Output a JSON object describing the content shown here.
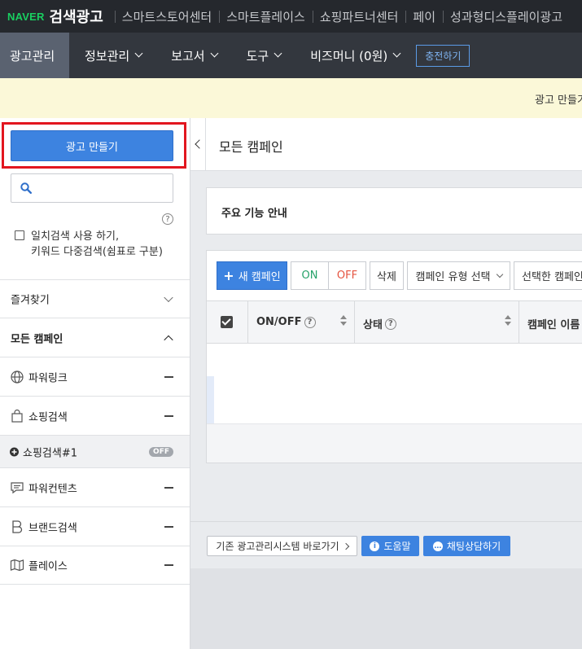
{
  "topbar": {
    "logo": "NAVER",
    "brand": "검색광고",
    "links": [
      "스마트스토어센터",
      "스마트플레이스",
      "쇼핑파트너센터",
      "페이",
      "성과형디스플레이광고"
    ]
  },
  "navbar": {
    "items": [
      {
        "label": "광고관리",
        "active": true
      },
      {
        "label": "정보관리",
        "dropdown": true
      },
      {
        "label": "보고서",
        "dropdown": true
      },
      {
        "label": "도구",
        "dropdown": true
      },
      {
        "label": "비즈머니 (0원)",
        "dropdown": true
      }
    ],
    "charge_label": "충전하기"
  },
  "notice": {
    "text": "광고 만들기"
  },
  "sidebar": {
    "create_label": "광고 만들기",
    "search_placeholder": "",
    "help_glyph": "?",
    "exact_match_line1": "일치검색 사용 하기,",
    "exact_match_line2": "키워드 다중검색(쉼표로 구분)",
    "favorites_label": "즐겨찾기",
    "all_campaigns_label": "모든 캠페인",
    "groups": [
      {
        "label": "파워링크",
        "icon": "globe-icon"
      },
      {
        "label": "쇼핑검색",
        "icon": "shopping-bag-icon"
      },
      {
        "label": "쇼핑검색#1",
        "icon": "plus-circle-icon",
        "badge": "OFF",
        "nested": true
      },
      {
        "label": "파워컨텐츠",
        "icon": "speech-bubble-icon"
      },
      {
        "label": "브랜드검색",
        "icon": "brand-b-icon"
      },
      {
        "label": "플레이스",
        "icon": "map-icon"
      }
    ]
  },
  "main": {
    "title": "모든 캠페인",
    "guide_title": "주요 기능 안내",
    "toolbar": {
      "new_campaign": "새 캠페인",
      "on": "ON",
      "off": "OFF",
      "delete": "삭제",
      "type_select": "캠페인 유형 선택",
      "selected_campaign": "선택한 캠페인"
    },
    "table": {
      "columns": [
        "ON/OFF",
        "상태",
        "캠페인 이름"
      ],
      "help_glyph": "?"
    },
    "footer": {
      "legacy": "기존 광고관리시스템 바로가기",
      "help": "도움말",
      "chat": "채팅상담하기"
    }
  },
  "colors": {
    "primary_blue": "#3d83e0",
    "highlight_red": "#e2161f",
    "naver_green": "#19ce60",
    "on_green": "#26a269",
    "off_red": "#e5533f"
  }
}
